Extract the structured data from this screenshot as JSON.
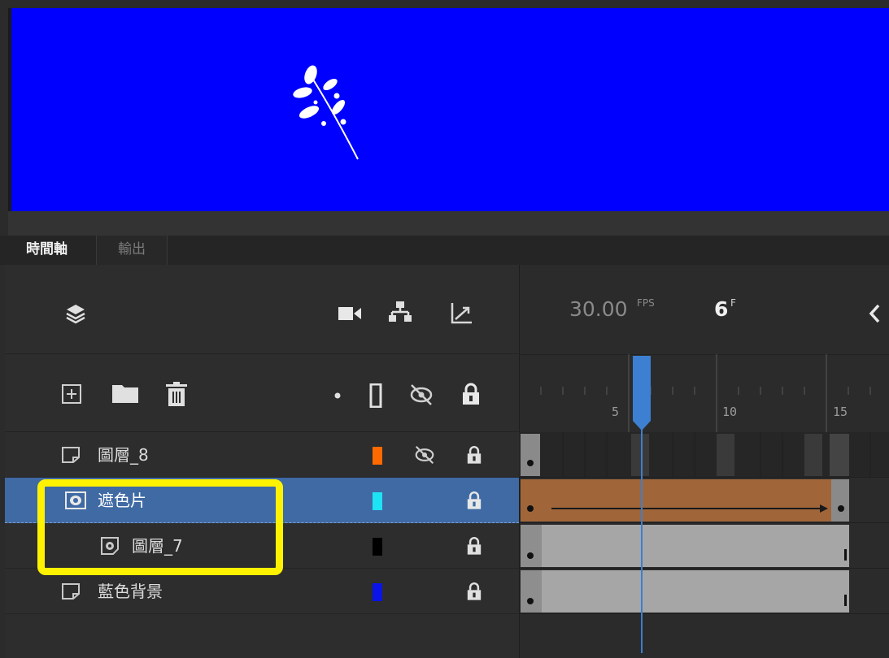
{
  "panel": {
    "tabs": [
      {
        "label": "時間軸",
        "active": true
      },
      {
        "label": "輸出",
        "active": false
      }
    ]
  },
  "timeline": {
    "fps": "30.00",
    "fps_unit": "FPS",
    "current_frame": "6",
    "frame_unit": "F",
    "ruler_labels": [
      "5",
      "10",
      "15"
    ]
  },
  "layers": [
    {
      "name": "圖層_8",
      "type": "normal",
      "color": "#ff6a00",
      "hidden": true,
      "locked": true
    },
    {
      "name": "遮色片",
      "type": "mask",
      "color": "#1ee3f4",
      "hidden": false,
      "locked": true,
      "selected": true
    },
    {
      "name": "圖層_7",
      "type": "masked",
      "color": "#000000",
      "hidden": false,
      "locked": true
    },
    {
      "name": "藍色背景",
      "type": "normal",
      "color": "#0a14e6",
      "hidden": false,
      "locked": true
    }
  ],
  "colors": {
    "stage_background": "#0000ff",
    "playhead": "#3d7fd0",
    "tween": "#a0663a",
    "highlight": "#fff200"
  }
}
